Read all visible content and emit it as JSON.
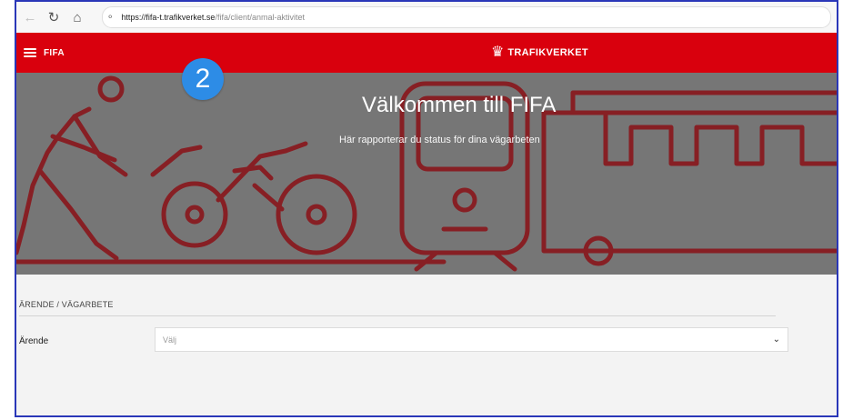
{
  "browser": {
    "back_icon": "arrow-left-icon",
    "reload_icon": "reload-icon",
    "home_icon": "home-icon",
    "url_host": "https://fifa-t.trafikverket.se",
    "url_path": "/fifa/client/anmal-aktivitet"
  },
  "header": {
    "menu_icon": "hamburger-icon",
    "app_name": "FIFA",
    "brand_icon": "trafikverket-crown-icon",
    "brand_name": "TRAFIKVERKET",
    "background_color": "#d9000d"
  },
  "step_badge": {
    "number": "2",
    "color": "#2d8ce6"
  },
  "hero": {
    "title": "Välkommen till FIFA",
    "subtitle": "Här rapporterar du status för dina vägarbeten"
  },
  "form": {
    "section_heading": "ÄRENDE / VÄGARBETE",
    "field_label": "Ärende",
    "select_placeholder": "Välj"
  }
}
